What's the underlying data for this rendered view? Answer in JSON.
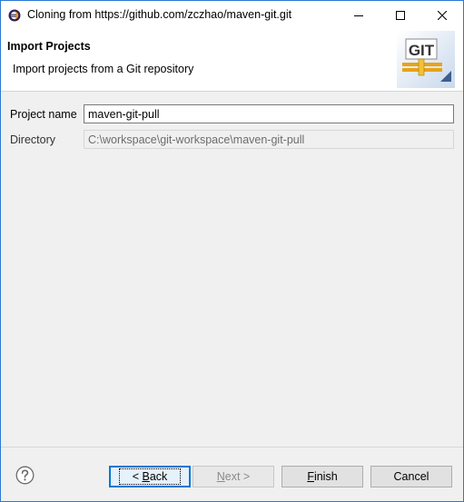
{
  "window": {
    "title": "Cloning from https://github.com/zczhao/maven-git.git",
    "icon": "eclipse-icon"
  },
  "banner": {
    "title": "Import Projects",
    "description": "Import projects from a Git repository",
    "graphic_text": "GIT",
    "graphic_icon": "git-import-wizard-icon"
  },
  "form": {
    "project_name_label": "Project name",
    "project_name_value": "maven-git-pull",
    "directory_label": "Directory",
    "directory_value": "C:\\workspace\\git-workspace\\maven-git-pull"
  },
  "buttons": {
    "back_prefix": "< ",
    "back_mnemonic": "B",
    "back_rest": "ack",
    "next_mnemonic": "N",
    "next_rest": "ext >",
    "finish_mnemonic": "F",
    "finish_rest": "inish",
    "cancel_label": "Cancel"
  },
  "colors": {
    "accent": "#0078d7",
    "window_border": "#2b78d4",
    "dialog_bg": "#f0f0f0"
  }
}
